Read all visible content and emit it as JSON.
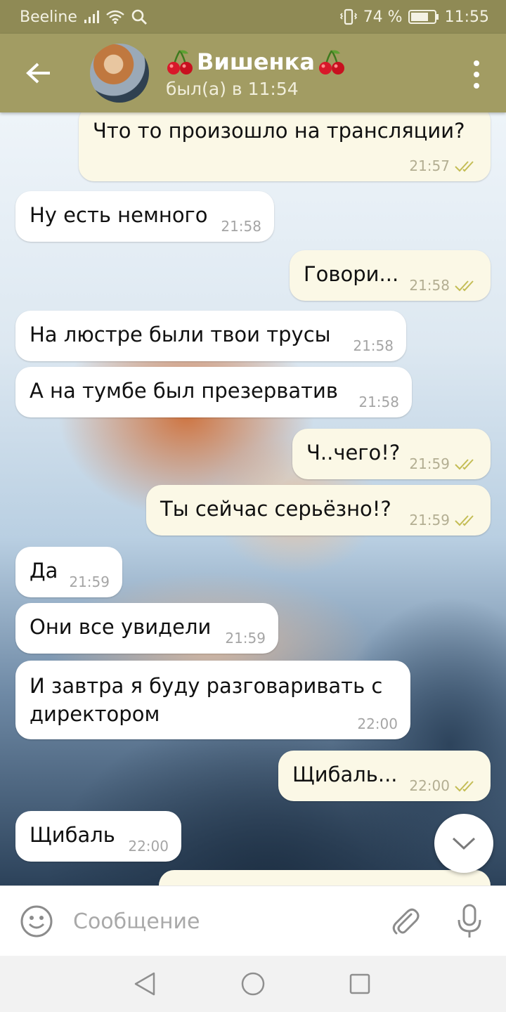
{
  "status_bar": {
    "carrier": "Beeline",
    "battery": "74 %",
    "time": "11:55"
  },
  "header": {
    "title": "Вишенка",
    "status": "был(а) в 11:54",
    "title_emoji": "cherries-icon"
  },
  "messages": [
    {
      "text": "Что то произошло на трансляции?",
      "time": "21:57",
      "outgoing": true
    },
    {
      "text": "Ну есть немного",
      "time": "21:58",
      "outgoing": false
    },
    {
      "text": "Говори...",
      "time": "21:58",
      "outgoing": true
    },
    {
      "text": "На люстре были твои трусы",
      "time": "21:58",
      "outgoing": false
    },
    {
      "text": "А на тумбе был презерватив",
      "time": "21:58",
      "outgoing": false
    },
    {
      "text": "Ч..чего!?",
      "time": "21:59",
      "outgoing": true
    },
    {
      "text": "Ты сейчас серьёзно!?",
      "time": "21:59",
      "outgoing": true
    },
    {
      "text": "Да",
      "time": "21:59",
      "outgoing": false
    },
    {
      "text": "Они все увидели",
      "time": "21:59",
      "outgoing": false
    },
    {
      "text": "И завтра я буду разговаривать с директором",
      "time": "22:00",
      "outgoing": false
    },
    {
      "text": "Щибаль...",
      "time": "22:00",
      "outgoing": true
    },
    {
      "text": "Щибаль",
      "time": "22:00",
      "outgoing": false
    }
  ],
  "input": {
    "placeholder": "Сообщение",
    "value": ""
  },
  "colors": {
    "header": "#a29c63",
    "status_bar": "#8f8a55",
    "outgoing_bubble": "#fbf8e6",
    "incoming_bubble": "#ffffff",
    "read_check": "#c4bd55"
  }
}
